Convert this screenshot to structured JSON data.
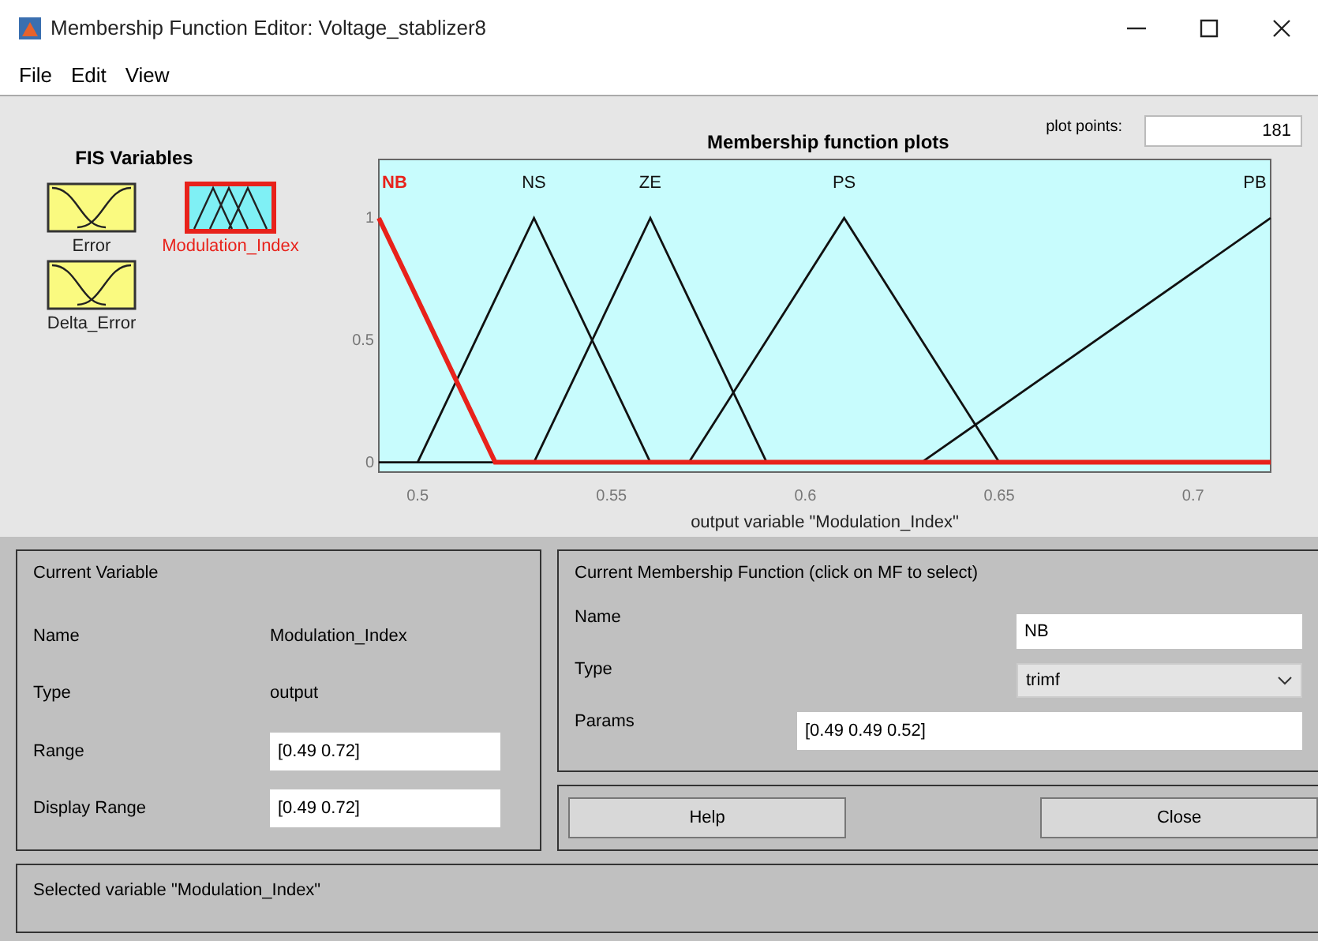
{
  "window": {
    "title": "Membership Function Editor: Voltage_stablizer8"
  },
  "menu": [
    "File",
    "Edit",
    "View"
  ],
  "fis_variables": {
    "title": "FIS Variables",
    "items": [
      {
        "name": "Error",
        "kind": "input",
        "selected": false
      },
      {
        "name": "Modulation_Index",
        "kind": "output",
        "selected": true
      },
      {
        "name": "Delta_Error",
        "kind": "input",
        "selected": false
      }
    ]
  },
  "plot": {
    "title": "Membership function plots",
    "plot_points_label": "plot points:",
    "plot_points": "181",
    "chart_data": {
      "type": "line",
      "xlabel": "output variable \"Modulation_Index\"",
      "xlim": [
        0.49,
        0.72
      ],
      "ylim": [
        -0.04,
        1.24
      ],
      "xticks": [
        0.5,
        0.55,
        0.6,
        0.65,
        0.7
      ],
      "yticks": [
        0,
        0.5,
        1
      ],
      "x": [
        0.49,
        0.5,
        0.52,
        0.53,
        0.56,
        0.57,
        0.59,
        0.61,
        0.63,
        0.65,
        0.72
      ],
      "series": [
        {
          "name": "NB",
          "color": "#e8221b",
          "values": [
            1,
            0.667,
            0,
            0,
            0,
            0,
            0,
            0,
            0,
            0,
            0
          ]
        },
        {
          "name": "NS",
          "color": "#111111",
          "values": [
            null,
            0,
            0.667,
            1,
            0,
            null,
            null,
            null,
            null,
            null,
            null
          ]
        },
        {
          "name": "ZE",
          "color": "#111111",
          "values": [
            null,
            null,
            null,
            0,
            1,
            0.667,
            0,
            null,
            null,
            null,
            null
          ]
        },
        {
          "name": "PS",
          "color": "#111111",
          "values": [
            null,
            null,
            null,
            null,
            null,
            0,
            0.5,
            1,
            0.5,
            0,
            null
          ]
        },
        {
          "name": "PB",
          "color": "#111111",
          "values": [
            null,
            null,
            null,
            null,
            null,
            null,
            null,
            null,
            0,
            0.222,
            1
          ]
        }
      ]
    }
  },
  "current_variable": {
    "title": "Current Variable",
    "rows": [
      {
        "label": "Name",
        "kind": "text",
        "value": "Modulation_Index"
      },
      {
        "label": "Type",
        "kind": "text",
        "value": "output"
      },
      {
        "label": "Range",
        "kind": "field",
        "value": "[0.49 0.72]"
      },
      {
        "label": "Display Range",
        "kind": "field",
        "value": "[0.49 0.72]"
      }
    ]
  },
  "current_mf": {
    "title": "Current Membership Function (click on MF to select)",
    "name_label": "Name",
    "name": "NB",
    "type_label": "Type",
    "type": "trimf",
    "params_label": "Params",
    "params": "[0.49 0.49 0.52]"
  },
  "buttons": [
    "Help",
    "Close"
  ],
  "status_bar": "Selected variable \"Modulation_Index\""
}
